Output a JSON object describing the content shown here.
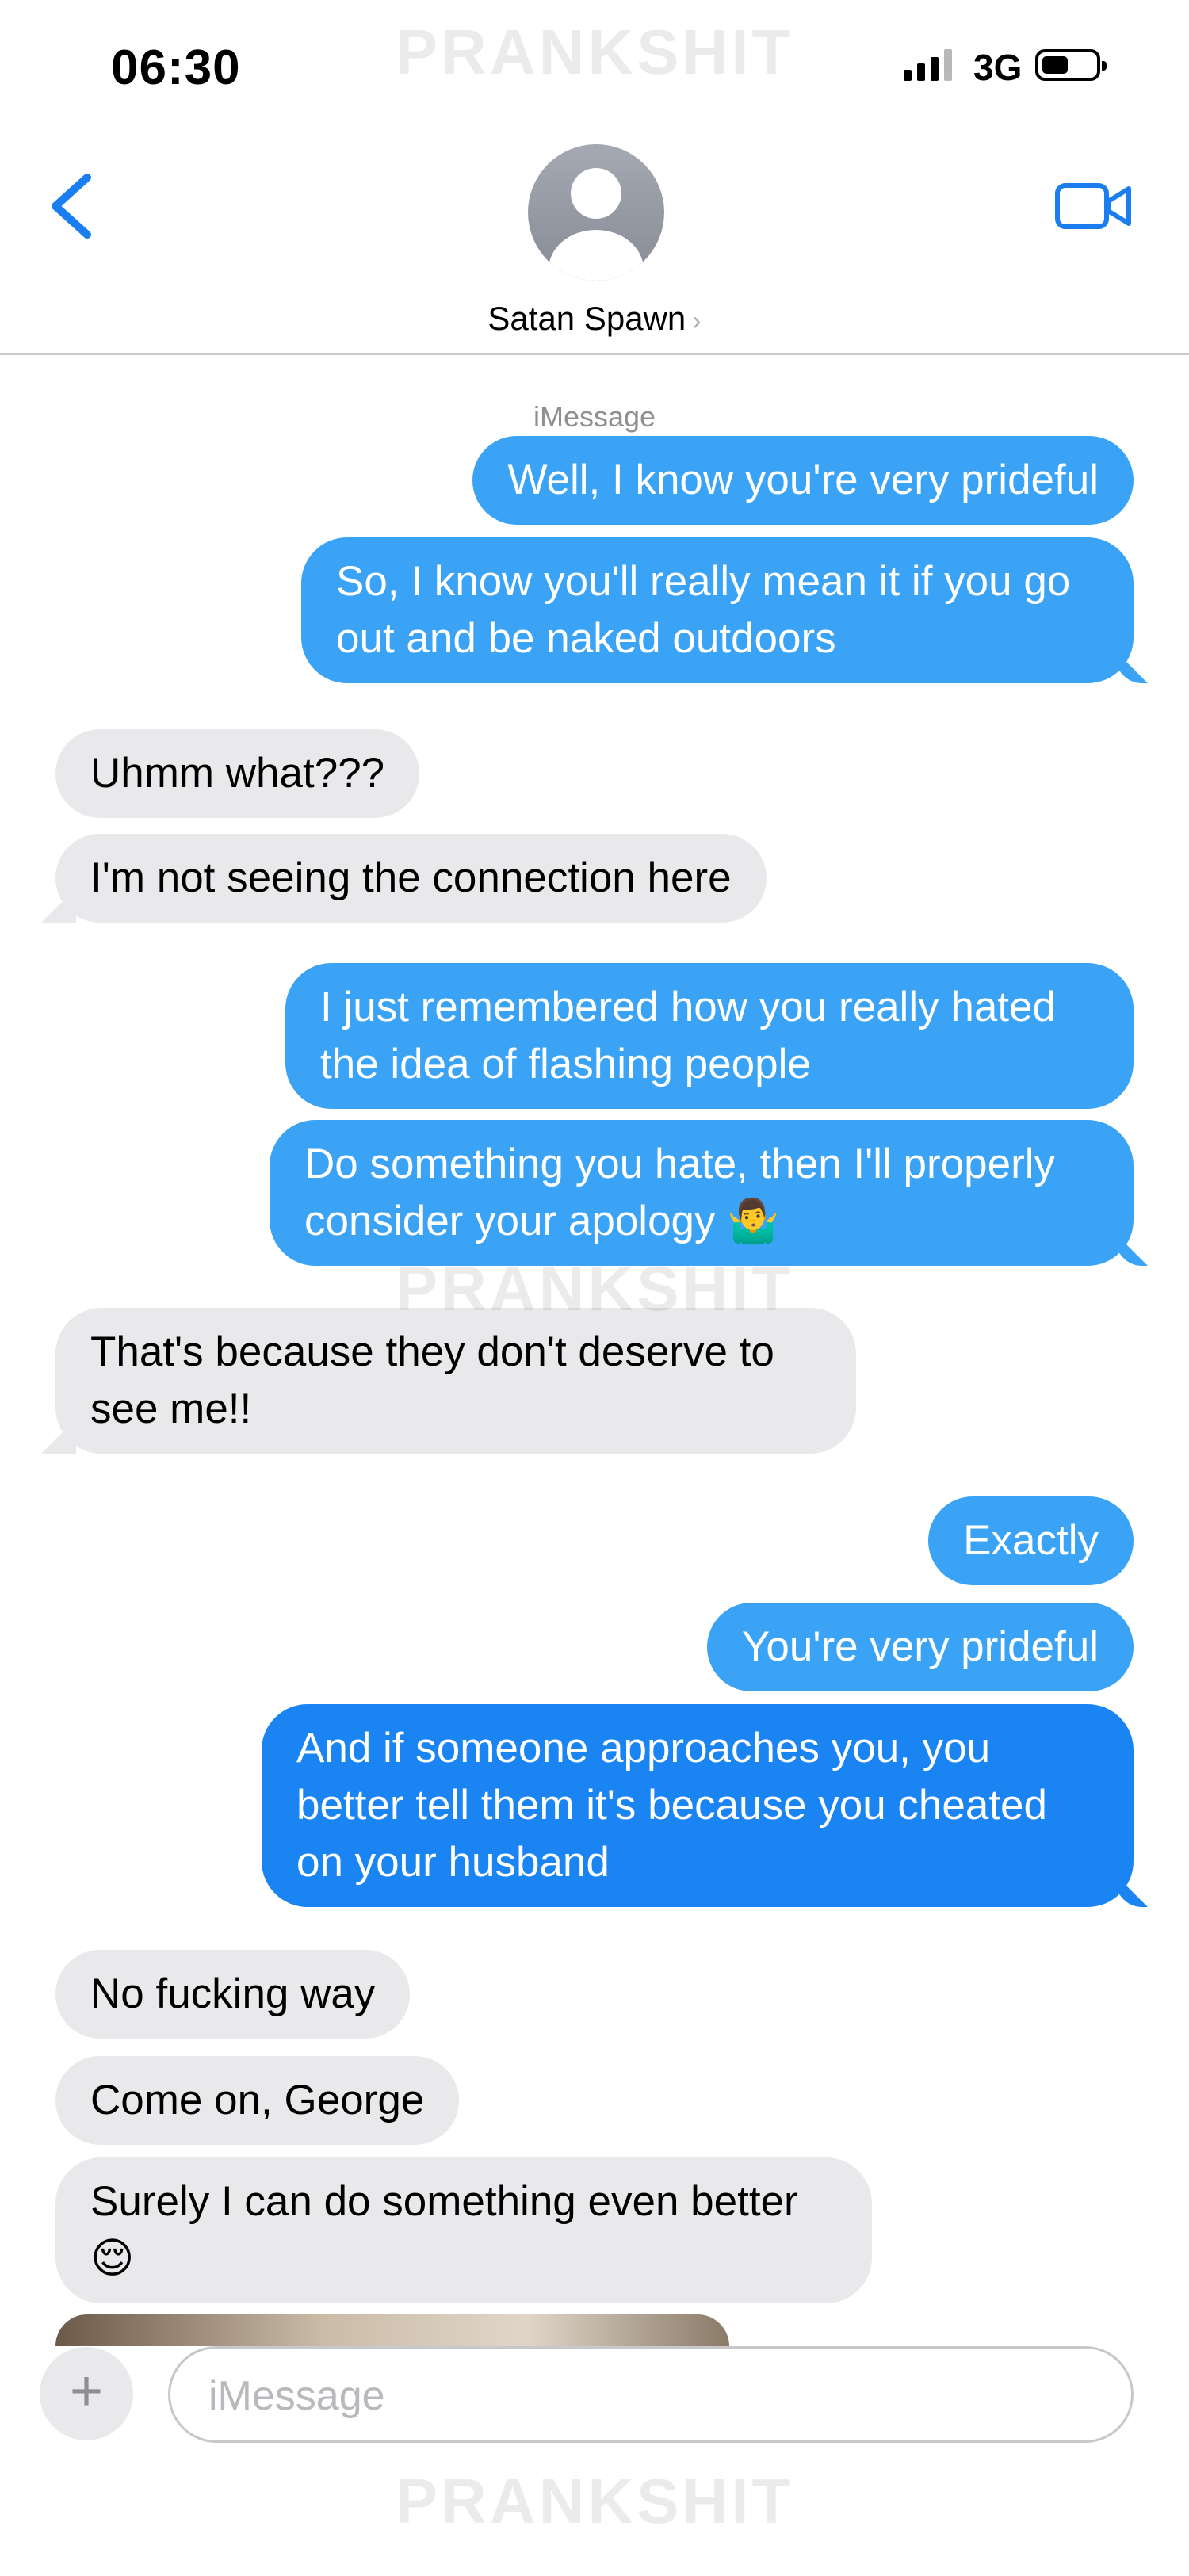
{
  "status_bar": {
    "time": "06:30",
    "network": "3G",
    "signal_bars": 4,
    "signal_bars_active": 3
  },
  "watermark": "PRANKSHIT",
  "header": {
    "contact_name": "Satan Spawn",
    "back_icon": "chevron-left-icon",
    "video_icon": "video-camera-icon"
  },
  "thread_label": "iMessage",
  "messages": [
    {
      "from": "me",
      "text": "Well, I know you're very prideful"
    },
    {
      "from": "me",
      "text": "So, I know you'll really mean it if you go out and be naked outdoors"
    },
    {
      "from": "them",
      "text": "Uhmm what???"
    },
    {
      "from": "them",
      "text": "I'm not seeing the connection here"
    },
    {
      "from": "me",
      "text": "I just remembered how you really hated the idea of flashing people"
    },
    {
      "from": "me",
      "text": "Do something you hate, then I'll properly consider your apology 🤷‍♂️"
    },
    {
      "from": "them",
      "text": "That's because they don't deserve to see me!!"
    },
    {
      "from": "me",
      "text": "Exactly"
    },
    {
      "from": "me",
      "text": "You're very prideful"
    },
    {
      "from": "me",
      "text": "And if someone approaches you, you better tell them it's because you cheated on your husband"
    },
    {
      "from": "them",
      "text": "No fucking way"
    },
    {
      "from": "them",
      "text": "Come on, George"
    },
    {
      "from": "them",
      "text": "Surely I can do something even better 😌"
    }
  ],
  "input": {
    "placeholder": "iMessage",
    "value": ""
  },
  "colors": {
    "sent": "#3ba3f5",
    "sent_latest": "#1a85f2",
    "received": "#e9e9eb",
    "accent": "#1a7ef0"
  }
}
